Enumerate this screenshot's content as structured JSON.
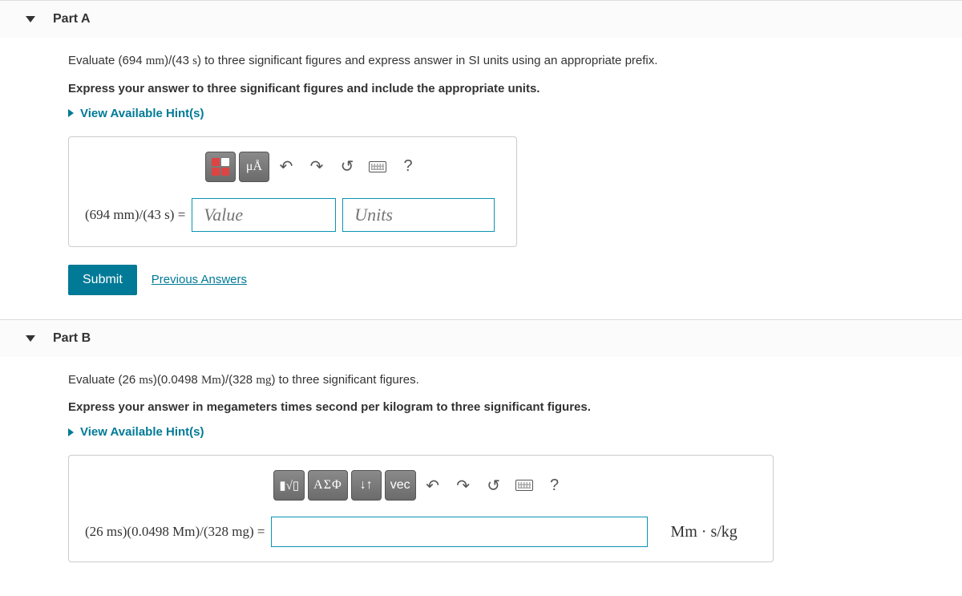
{
  "partA": {
    "title": "Part A",
    "prompt_pre": "Evaluate (694 ",
    "prompt_unit1": "mm",
    "prompt_mid": ")/(43 ",
    "prompt_unit2": "s",
    "prompt_post": ") to three significant figures and express answer in SI units using an appropriate prefix.",
    "instruction": "Express your answer to three significant figures and include the appropriate units.",
    "hints": "View Available Hint(s)",
    "expr_pre": "(694 ",
    "expr_u1": "mm",
    "expr_mid": ")/(43 ",
    "expr_u2": "s",
    "expr_post": ") =",
    "value_placeholder": "Value",
    "units_placeholder": "Units",
    "submit": "Submit",
    "previous": "Previous Answers",
    "toolbar": {
      "muA": "μÅ",
      "help": "?"
    }
  },
  "partB": {
    "title": "Part B",
    "prompt_pre": "Evaluate (26 ",
    "prompt_u1": "ms",
    "prompt_mid1": ")(0.0498 ",
    "prompt_u2": "Mm",
    "prompt_mid2": ")/(328 ",
    "prompt_u3": "mg",
    "prompt_post": ") to three significant figures.",
    "instruction": "Express your answer in megameters times second per kilogram to three significant figures.",
    "hints": "View Available Hint(s)",
    "expr_pre": "(26 ",
    "expr_u1": "ms",
    "expr_mid1": ")(0.0498 ",
    "expr_u2": "Mm",
    "expr_mid2": ")/(328 ",
    "expr_u3": "mg",
    "expr_post": ") =",
    "unit_suffix": "Mm · s/kg",
    "toolbar": {
      "asigma": "ΑΣΦ",
      "subsuper": "↓↑",
      "vec": "vec",
      "help": "?"
    }
  }
}
